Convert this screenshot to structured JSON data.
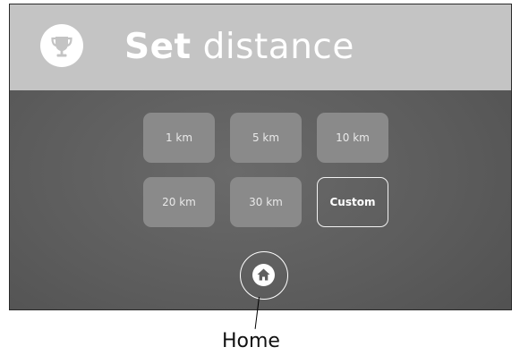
{
  "header": {
    "title_bold": "Set",
    "title_light": "distance",
    "icon": "trophy-icon",
    "background": "#c4c4c4"
  },
  "distance_options": [
    {
      "label": "1 km",
      "style": "filled"
    },
    {
      "label": "5 km",
      "style": "filled"
    },
    {
      "label": "10 km",
      "style": "filled"
    },
    {
      "label": "20 km",
      "style": "filled"
    },
    {
      "label": "30 km",
      "style": "filled"
    },
    {
      "label": "Custom",
      "style": "outlined"
    }
  ],
  "home_button": {
    "icon": "home-icon"
  },
  "callout": {
    "label": "Home"
  }
}
